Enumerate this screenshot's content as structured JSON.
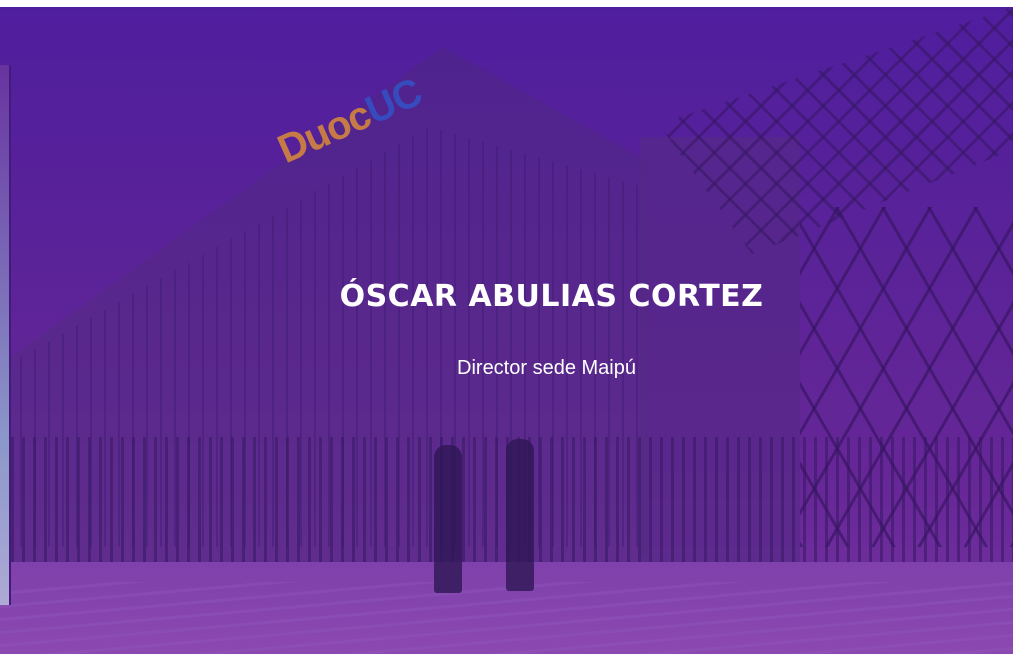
{
  "hero": {
    "name": "ÓSCAR ABULIAS CORTEZ",
    "role": "Director sede Maipú",
    "building_sign": {
      "part1": "Duoc",
      "part2": "UC"
    }
  },
  "colors": {
    "overlay_purple": "#5a2496",
    "text": "#ffffff",
    "sign_orange": "#e89a2a",
    "sign_blue": "#2a58c8"
  }
}
